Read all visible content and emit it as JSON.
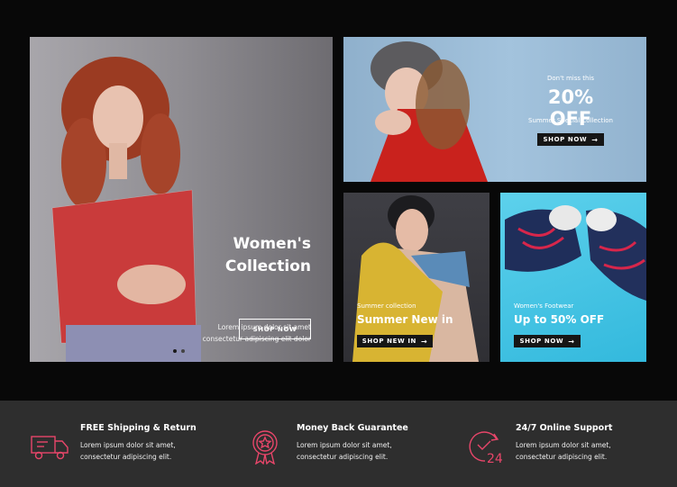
{
  "main_banner": {
    "title_line1": "Women's",
    "title_line2": "Collection",
    "desc_line1": "Lorem ipsum dolor sit amet",
    "desc_line2": "consectetur adipiscing elit dolor",
    "button": "SHOP NOW"
  },
  "top_banner": {
    "kicker": "Don't miss this",
    "headline": "20% OFF",
    "subtitle": "Summer Special Collection",
    "button": "SHOP NOW"
  },
  "bottom_left_banner": {
    "kicker": "Summer collection",
    "title": "Summer New in",
    "button": "SHOP NEW IN"
  },
  "bottom_right_banner": {
    "kicker": "Women's Footwear",
    "title": "Up to 50% OFF",
    "button": "SHOP NOW"
  },
  "features": [
    {
      "icon": "truck-icon",
      "title": "FREE Shipping & Return",
      "line1": "Lorem ipsum dolor sit amet,",
      "line2": "consectetur adipiscing elit."
    },
    {
      "icon": "badge-icon",
      "title": "Money Back Guarantee",
      "line1": "Lorem ipsum dolor sit amet,",
      "line2": "consectetur adipiscing elit."
    },
    {
      "icon": "support-24-icon",
      "title": "24/7 Online Support",
      "line1": "Lorem ipsum dolor sit amet,",
      "line2": "consectetur adipiscing elit."
    }
  ],
  "colors": {
    "accent": "#e8466a",
    "feature_bg": "#2e2e2e",
    "button_dark": "#161616"
  }
}
